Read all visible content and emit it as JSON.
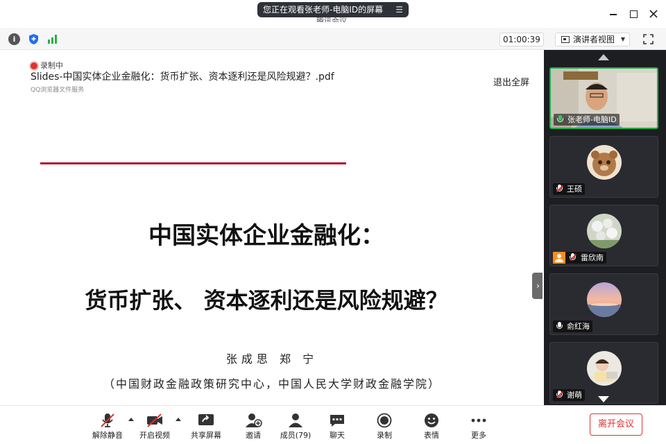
{
  "titlebar": {
    "share_banner": "您正在观看张老师-电脑ID的屏幕",
    "share_menu_icon": "list-icon",
    "hidden_meeting_title": "腾讯会议"
  },
  "toolbar": {
    "timer": "01:00:39",
    "view_mode": "演讲者视图"
  },
  "presentation": {
    "recording_label": "录制中",
    "doc_title": "Slides-中国实体企业金融化：货币扩张、资本逐利还是风险规避？.pdf",
    "doc_source": "QQ浏览器文件服务",
    "exit_fullscreen": "退出全屏",
    "slide": {
      "title_line1": "中国实体企业金融化：",
      "title_line2": "货币扩张、 资本逐利还是风险规避？",
      "authors": "张成思  郑 宁",
      "affiliation": "（中国财政金融政策研究中心，中国人民大学财政金融学院）",
      "rule_color": "#b0142b"
    }
  },
  "participants": [
    {
      "name": "张老师-电脑ID",
      "mic": "on",
      "active": true
    },
    {
      "name": "王硕",
      "mic": "muted",
      "active": false
    },
    {
      "name": "雷欣南",
      "mic": "muted",
      "active": false,
      "badge": true
    },
    {
      "name": "俞红海",
      "mic": "unmuted",
      "active": false
    },
    {
      "name": "谢萌",
      "mic": "muted",
      "active": false
    }
  ],
  "bottombar": {
    "unmute": "解除静音",
    "video": "开启视频",
    "share": "共享屏幕",
    "invite": "邀请",
    "members": "成员(79)",
    "chat": "聊天",
    "record": "录制",
    "reactions": "表情",
    "more": "更多",
    "leave": "离开会议"
  },
  "colors": {
    "accent_green": "#1fb04b",
    "leave_red": "#e03131",
    "panel_bg": "#1d1e22"
  }
}
